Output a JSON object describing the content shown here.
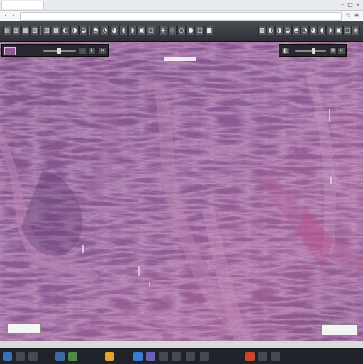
{
  "browser": {
    "tab_title": "",
    "url": ""
  },
  "toolbar": {
    "buttons_left": [
      "open-icon",
      "save-icon",
      "print-icon",
      "zoom-in-icon",
      "zoom-out-icon",
      "fit-icon",
      "rotate-icon",
      "pan-icon",
      "select-icon",
      "ruler-icon",
      "annotate-icon",
      "text-icon",
      "rect-icon",
      "ellipse-icon",
      "arrow-icon",
      "freehand-icon",
      "color-icon",
      "layers-icon",
      "grid-icon",
      "snapshot-icon",
      "settings-icon",
      "help-icon"
    ],
    "buttons_right": [
      "prev-slide-icon",
      "next-slide-icon",
      "first-icon",
      "last-icon",
      "refresh-icon",
      "info-icon",
      "fullscreen-icon",
      "close-icon",
      "menu-icon",
      "share-icon",
      "export-icon",
      "zoom-box-icon"
    ]
  },
  "nav_left": {
    "label": ""
  },
  "nav_right": {
    "label": ""
  },
  "viewport": {
    "top_label": "",
    "scale_left": "",
    "scale_right": ""
  },
  "status": {
    "left_text": "",
    "right_text": "",
    "clock": ""
  },
  "colors": {
    "tissue_base": "#6a3d6e",
    "tissue_dark": "#4a2a58",
    "tissue_pink": "#b06a9c",
    "stroma": "#c88ab4"
  }
}
